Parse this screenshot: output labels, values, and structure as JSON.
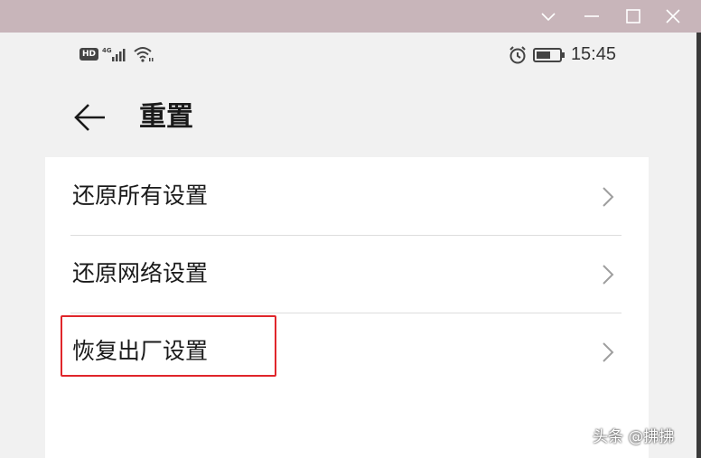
{
  "window": {
    "titlebar_color": "#c8b5ba",
    "controls": [
      "chevron-down-icon",
      "minimize-icon",
      "maximize-icon",
      "close-icon"
    ]
  },
  "status_bar": {
    "hd_badge": "HD",
    "network": "4G",
    "time": "15:45",
    "icons": [
      "signal-icon",
      "wifi-icon",
      "alarm-icon",
      "battery-icon"
    ]
  },
  "header": {
    "title": "重置",
    "back_icon": "back-arrow-icon"
  },
  "menu": {
    "items": [
      {
        "label": "还原所有设置"
      },
      {
        "label": "还原网络设置"
      },
      {
        "label": "恢复出厂设置"
      }
    ]
  },
  "annotation": {
    "highlight_color": "#e0262b",
    "highlighted_item": "恢复出厂设置"
  },
  "watermark": {
    "text": "头条 @拂拂"
  }
}
